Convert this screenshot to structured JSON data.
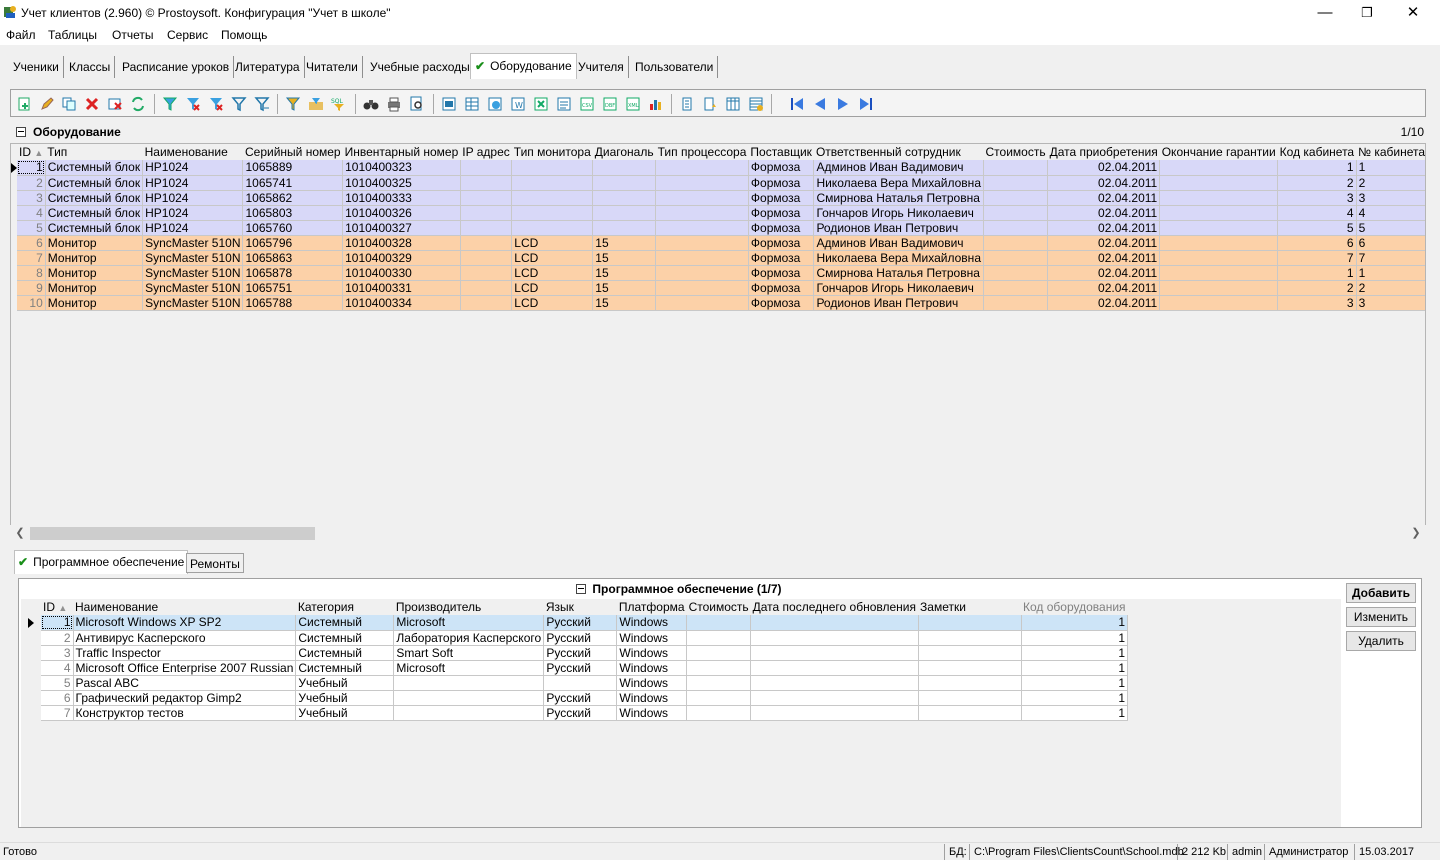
{
  "window": {
    "title": "Учет клиентов (2.960) © Prostoysoft. Конфигурация \"Учет в школе\"",
    "minimize": "—",
    "restore": "❐",
    "close": "✕"
  },
  "menu": [
    "Файл",
    "Таблицы",
    "Отчеты",
    "Сервис",
    "Помощь"
  ],
  "tabs": [
    "Ученики",
    "Классы",
    "Расписание уроков",
    "Литература",
    "Читатели",
    "Учебные расходы",
    "Оборудование",
    "Учителя",
    "Пользователи"
  ],
  "active_tab": "Оборудование",
  "panel": {
    "title": "Оборудование",
    "count": "1/10"
  },
  "equipment_grid": {
    "columns": [
      "ID",
      "Тип",
      "Наименование",
      "Серийный номер",
      "Инвентарный номер",
      "IP адрес",
      "Тип монитора",
      "Диагональ",
      "Тип процессора",
      "Поставщик",
      "Ответственный сотрудник",
      "Стоимость",
      "Дата приобретения",
      "Окончание гарантии",
      "Код кабинета",
      "№ кабинета"
    ],
    "rows": [
      {
        "id": "1",
        "type": "Системный блок",
        "name": "HP1024",
        "serial": "1065889",
        "inv": "1010400323",
        "ip": "",
        "mon": "",
        "diag": "",
        "cpu": "",
        "supplier": "Формоза",
        "person": "Админов Иван Вадимович",
        "cost": "",
        "date": "02.04.2011",
        "warranty": "",
        "room_code": "1",
        "room": "1"
      },
      {
        "id": "2",
        "type": "Системный блок",
        "name": "HP1024",
        "serial": "1065741",
        "inv": "1010400325",
        "ip": "",
        "mon": "",
        "diag": "",
        "cpu": "",
        "supplier": "Формоза",
        "person": "Николаева Вера Михайловна",
        "cost": "",
        "date": "02.04.2011",
        "warranty": "",
        "room_code": "2",
        "room": "2"
      },
      {
        "id": "3",
        "type": "Системный блок",
        "name": "HP1024",
        "serial": "1065862",
        "inv": "1010400333",
        "ip": "",
        "mon": "",
        "diag": "",
        "cpu": "",
        "supplier": "Формоза",
        "person": "Смирнова Наталья Петровна",
        "cost": "",
        "date": "02.04.2011",
        "warranty": "",
        "room_code": "3",
        "room": "3"
      },
      {
        "id": "4",
        "type": "Системный блок",
        "name": "HP1024",
        "serial": "1065803",
        "inv": "1010400326",
        "ip": "",
        "mon": "",
        "diag": "",
        "cpu": "",
        "supplier": "Формоза",
        "person": "Гончаров Игорь Николаевич",
        "cost": "",
        "date": "02.04.2011",
        "warranty": "",
        "room_code": "4",
        "room": "4"
      },
      {
        "id": "5",
        "type": "Системный блок",
        "name": "HP1024",
        "serial": "1065760",
        "inv": "1010400327",
        "ip": "",
        "mon": "",
        "diag": "",
        "cpu": "",
        "supplier": "Формоза",
        "person": "Родионов Иван Петрович",
        "cost": "",
        "date": "02.04.2011",
        "warranty": "",
        "room_code": "5",
        "room": "5"
      },
      {
        "id": "6",
        "type": "Монитор",
        "name": "SyncMaster 510N",
        "serial": "1065796",
        "inv": "1010400328",
        "ip": "",
        "mon": "LCD",
        "diag": "15",
        "cpu": "",
        "supplier": "Формоза",
        "person": "Админов Иван Вадимович",
        "cost": "",
        "date": "02.04.2011",
        "warranty": "",
        "room_code": "6",
        "room": "6"
      },
      {
        "id": "7",
        "type": "Монитор",
        "name": "SyncMaster 510N",
        "serial": "1065863",
        "inv": "1010400329",
        "ip": "",
        "mon": "LCD",
        "diag": "15",
        "cpu": "",
        "supplier": "Формоза",
        "person": "Николаева Вера Михайловна",
        "cost": "",
        "date": "02.04.2011",
        "warranty": "",
        "room_code": "7",
        "room": "7"
      },
      {
        "id": "8",
        "type": "Монитор",
        "name": "SyncMaster 510N",
        "serial": "1065878",
        "inv": "1010400330",
        "ip": "",
        "mon": "LCD",
        "diag": "15",
        "cpu": "",
        "supplier": "Формоза",
        "person": "Смирнова Наталья Петровна",
        "cost": "",
        "date": "02.04.2011",
        "warranty": "",
        "room_code": "1",
        "room": "1"
      },
      {
        "id": "9",
        "type": "Монитор",
        "name": "SyncMaster 510N",
        "serial": "1065751",
        "inv": "1010400331",
        "ip": "",
        "mon": "LCD",
        "diag": "15",
        "cpu": "",
        "supplier": "Формоза",
        "person": "Гончаров Игорь Николаевич",
        "cost": "",
        "date": "02.04.2011",
        "warranty": "",
        "room_code": "2",
        "room": "2"
      },
      {
        "id": "10",
        "type": "Монитор",
        "name": "SyncMaster 510N",
        "serial": "1065788",
        "inv": "1010400334",
        "ip": "",
        "mon": "LCD",
        "diag": "15",
        "cpu": "",
        "supplier": "Формоза",
        "person": "Родионов Иван Петрович",
        "cost": "",
        "date": "02.04.2011",
        "warranty": "",
        "room_code": "3",
        "room": "3"
      }
    ]
  },
  "bottom_tabs": [
    "Программное обеспечение",
    "Ремонты"
  ],
  "software_panel": {
    "title": "Программное обеспечение (1/7)",
    "columns": [
      "ID",
      "Наименование",
      "Категория",
      "Производитель",
      "Язык",
      "Платформа",
      "Стоимость",
      "Дата последнего обновления",
      "Заметки",
      "Код оборудования"
    ],
    "rows": [
      {
        "id": "1",
        "name": "Microsoft Windows XP SP2",
        "cat": "Системный",
        "vendor": "Microsoft",
        "lang": "Русский",
        "platform": "Windows",
        "cost": "",
        "updated": "",
        "notes": "",
        "eq": "1"
      },
      {
        "id": "2",
        "name": "Антивирус Касперского",
        "cat": "Системный",
        "vendor": "Лаборатория Касперского",
        "lang": "Русский",
        "platform": "Windows",
        "cost": "",
        "updated": "",
        "notes": "",
        "eq": "1"
      },
      {
        "id": "3",
        "name": "Traffic Inspector",
        "cat": "Системный",
        "vendor": "Smart Soft",
        "lang": "Русский",
        "platform": "Windows",
        "cost": "",
        "updated": "",
        "notes": "",
        "eq": "1"
      },
      {
        "id": "4",
        "name": "Microsoft Office Enterprise 2007 Russian",
        "cat": "Системный",
        "vendor": "Microsoft",
        "lang": "Русский",
        "platform": "Windows",
        "cost": "",
        "updated": "",
        "notes": "",
        "eq": "1"
      },
      {
        "id": "5",
        "name": "Pascal ABC",
        "cat": "Учебный",
        "vendor": "",
        "lang": "",
        "platform": "Windows",
        "cost": "",
        "updated": "",
        "notes": "",
        "eq": "1"
      },
      {
        "id": "6",
        "name": "Графический редактор Gimp2",
        "cat": "Учебный",
        "vendor": "",
        "lang": "Русский",
        "platform": "Windows",
        "cost": "",
        "updated": "",
        "notes": "",
        "eq": "1"
      },
      {
        "id": "7",
        "name": "Конструктор тестов",
        "cat": "Учебный",
        "vendor": "",
        "lang": "Русский",
        "platform": "Windows",
        "cost": "",
        "updated": "",
        "notes": "",
        "eq": "1"
      }
    ]
  },
  "side_buttons": {
    "add": "Добавить",
    "edit": "Изменить",
    "delete": "Удалить"
  },
  "status": {
    "ready": "Готово",
    "db_label": "БД:",
    "db_path": "C:\\Program Files\\ClientsCount\\School.mdb",
    "size": "2 212 Kb",
    "user": "admin",
    "role": "Администратор",
    "date": "15.03.2017"
  },
  "colors": {
    "row_blue": "#d8d8f8",
    "row_orange": "#fcd1a8",
    "row_selected": "#cde4f7",
    "check_green": "#1a8f1a"
  }
}
